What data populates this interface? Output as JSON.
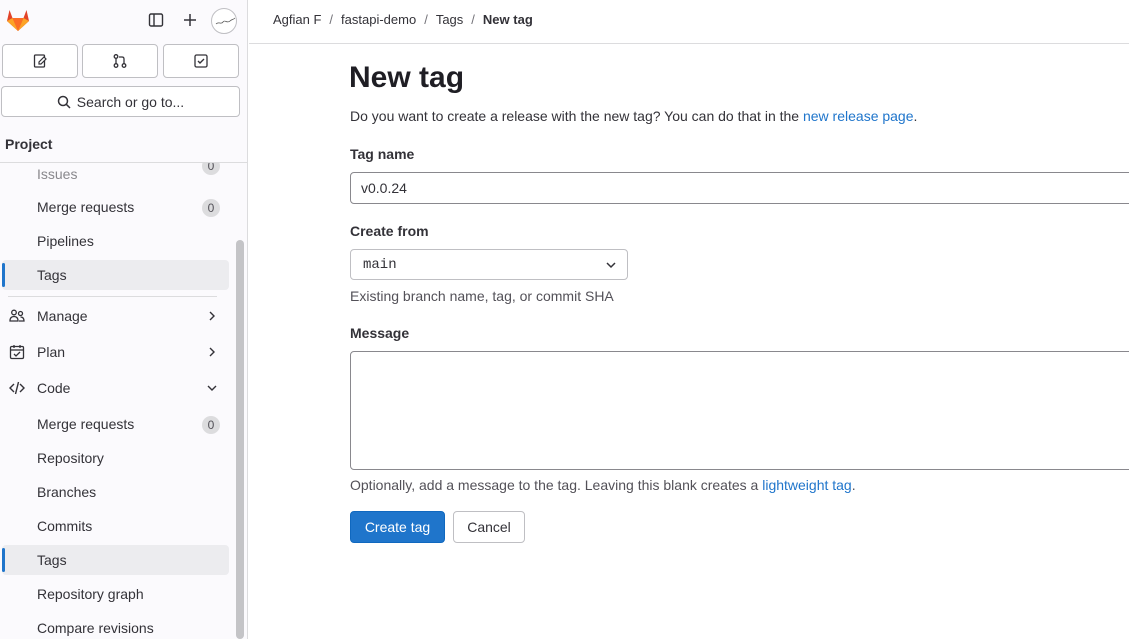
{
  "breadcrumb": {
    "items": [
      "Agfian F",
      "fastapi-demo",
      "Tags"
    ],
    "current": "New tag"
  },
  "search": {
    "label": "Search or go to..."
  },
  "sidebar": {
    "heading": "Project",
    "items": {
      "issues": {
        "label": "Issues",
        "count": "0"
      },
      "merge_requests_top": {
        "label": "Merge requests",
        "count": "0"
      },
      "pipelines": {
        "label": "Pipelines"
      },
      "tags_top": {
        "label": "Tags"
      },
      "manage": {
        "label": "Manage"
      },
      "plan": {
        "label": "Plan"
      },
      "code": {
        "label": "Code"
      },
      "merge_requests": {
        "label": "Merge requests",
        "count": "0"
      },
      "repository": {
        "label": "Repository"
      },
      "branches": {
        "label": "Branches"
      },
      "commits": {
        "label": "Commits"
      },
      "tags": {
        "label": "Tags"
      },
      "repository_graph": {
        "label": "Repository graph"
      },
      "compare_revisions": {
        "label": "Compare revisions"
      }
    }
  },
  "form": {
    "title": "New tag",
    "desc_before": "Do you want to create a release with the new tag? You can do that in the ",
    "desc_link": "new release page",
    "desc_after": ".",
    "tag_name_label": "Tag name",
    "tag_name_value": "v0.0.24",
    "create_from_label": "Create from",
    "create_from_value": "main",
    "create_from_help": "Existing branch name, tag, or commit SHA",
    "message_label": "Message",
    "message_value": "",
    "message_help_before": "Optionally, add a message to the tag. Leaving this blank creates a ",
    "message_help_link": "lightweight tag",
    "message_help_after": ".",
    "submit_label": "Create tag",
    "cancel_label": "Cancel"
  },
  "colors": {
    "accent": "#1f75cb",
    "logo": "#e24329"
  }
}
